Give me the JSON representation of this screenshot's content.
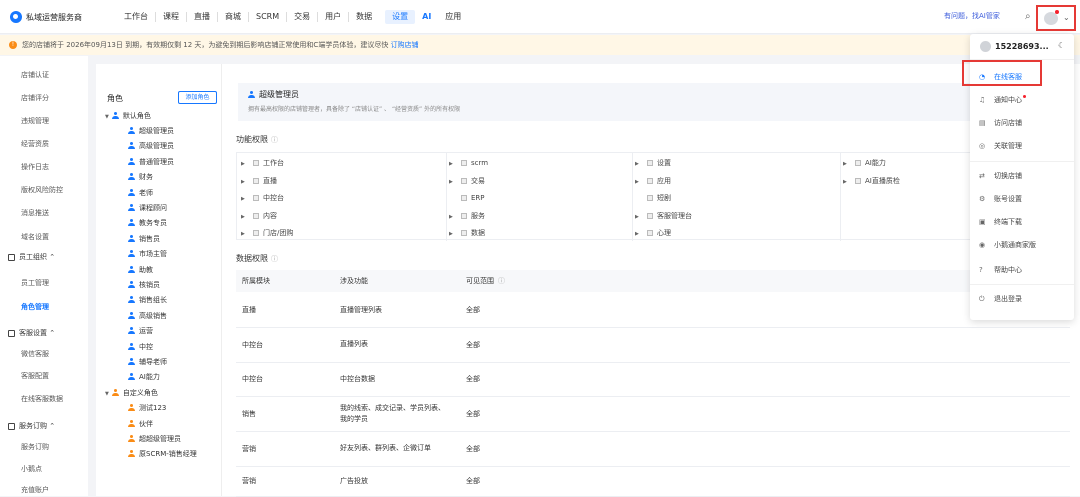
{
  "brand": "私域运营服务商",
  "nav": [
    "工作台",
    "课程",
    "直播",
    "商城",
    "SCRM",
    "交易",
    "用户",
    "数据",
    "设置",
    "AI",
    "应用"
  ],
  "nav_active": "设置",
  "ask": "有问题，找AI管家",
  "notice": {
    "text": "您的店铺将于 2026年09月13日 到期，有效期仅剩 12 天，为避免到期后影响店铺正常使用和C端学员体验，建议尽快",
    "link": "订购店铺"
  },
  "sidebar": [
    {
      "type": "item",
      "label": "店铺认证"
    },
    {
      "type": "item",
      "label": "店铺评分"
    },
    {
      "type": "item",
      "label": "违规管理"
    },
    {
      "type": "item",
      "label": "经营资质"
    },
    {
      "type": "item",
      "label": "操作日志"
    },
    {
      "type": "item",
      "label": "版权风险防控"
    },
    {
      "type": "item",
      "label": "消息推送"
    },
    {
      "type": "item",
      "label": "域名设置"
    },
    {
      "type": "group",
      "label": "员工组织"
    },
    {
      "type": "item",
      "label": "员工管理"
    },
    {
      "type": "item",
      "label": "角色管理",
      "active": true
    },
    {
      "type": "group",
      "label": "客服设置"
    },
    {
      "type": "item",
      "label": "微信客服"
    },
    {
      "type": "item",
      "label": "客服配置"
    },
    {
      "type": "item",
      "label": "在线客服数据"
    },
    {
      "type": "group",
      "label": "服务订购"
    },
    {
      "type": "item",
      "label": "服务订购"
    },
    {
      "type": "item",
      "label": "小鹅点"
    },
    {
      "type": "item",
      "label": "充值账户"
    }
  ],
  "roles": {
    "title": "角色",
    "add_button": "添加角色",
    "default_group": "默认角色",
    "default": [
      "超级管理员",
      "高级管理员",
      "普通管理员",
      "财务",
      "老师",
      "课程顾问",
      "教务专员",
      "销售员",
      "市场主管",
      "助教",
      "核销员",
      "销售组长",
      "高级销售",
      "运营",
      "中控",
      "辅导老师",
      "AI能力"
    ],
    "custom_group": "自定义角色",
    "custom": [
      "测试123",
      "伙伴",
      "超超级管理员",
      "原SCRM-销售经理"
    ]
  },
  "header": {
    "title": "超级管理员",
    "desc": "拥有最高权限的店铺管理者，具备除了 “店铺认证” 、 “经营资质” 外的所有权限"
  },
  "function_title": "功能权限",
  "perm_cols": [
    [
      "工作台",
      "直播",
      "中控台",
      "内容",
      "门店/团购"
    ],
    [
      "scrm",
      "交易",
      "ERP",
      "服务",
      "数据"
    ],
    [
      "设置",
      "应用",
      "短剧",
      "客服管理台",
      "心理"
    ],
    [
      "AI能力",
      "AI直播质检"
    ]
  ],
  "no_arrow": [
    "ERP",
    "短剧"
  ],
  "data_title": "数据权限",
  "table": {
    "columns": [
      "所属模块",
      "涉及功能",
      "可见范围"
    ],
    "rows": [
      [
        "直播",
        "直播管理列表",
        "全部"
      ],
      [
        "中控台",
        "直播列表",
        "全部"
      ],
      [
        "中控台",
        "中控台数据",
        "全部"
      ],
      [
        "销售",
        "我的线索、成交记录、学员列表、我的学员",
        "全部"
      ],
      [
        "营销",
        "好友列表、群列表、企微订单",
        "全部"
      ],
      [
        "营销",
        "广告投放",
        "全部"
      ]
    ]
  },
  "menu": {
    "user": "15228693...",
    "items": [
      "在线客服",
      "通知中心",
      "访问店铺",
      "关联管理",
      "切换店铺",
      "账号设置",
      "终端下载",
      "小鹅通商家版",
      "帮助中心",
      "退出登录"
    ],
    "icons": [
      "◔",
      "♫",
      "▤",
      "◎",
      "⇄",
      "⚙",
      "▣",
      "◉",
      "?",
      "⏻"
    ]
  },
  "colors": {
    "accent": "#1677ff",
    "highlight": "#e53935",
    "warn": "#fa8c16"
  }
}
